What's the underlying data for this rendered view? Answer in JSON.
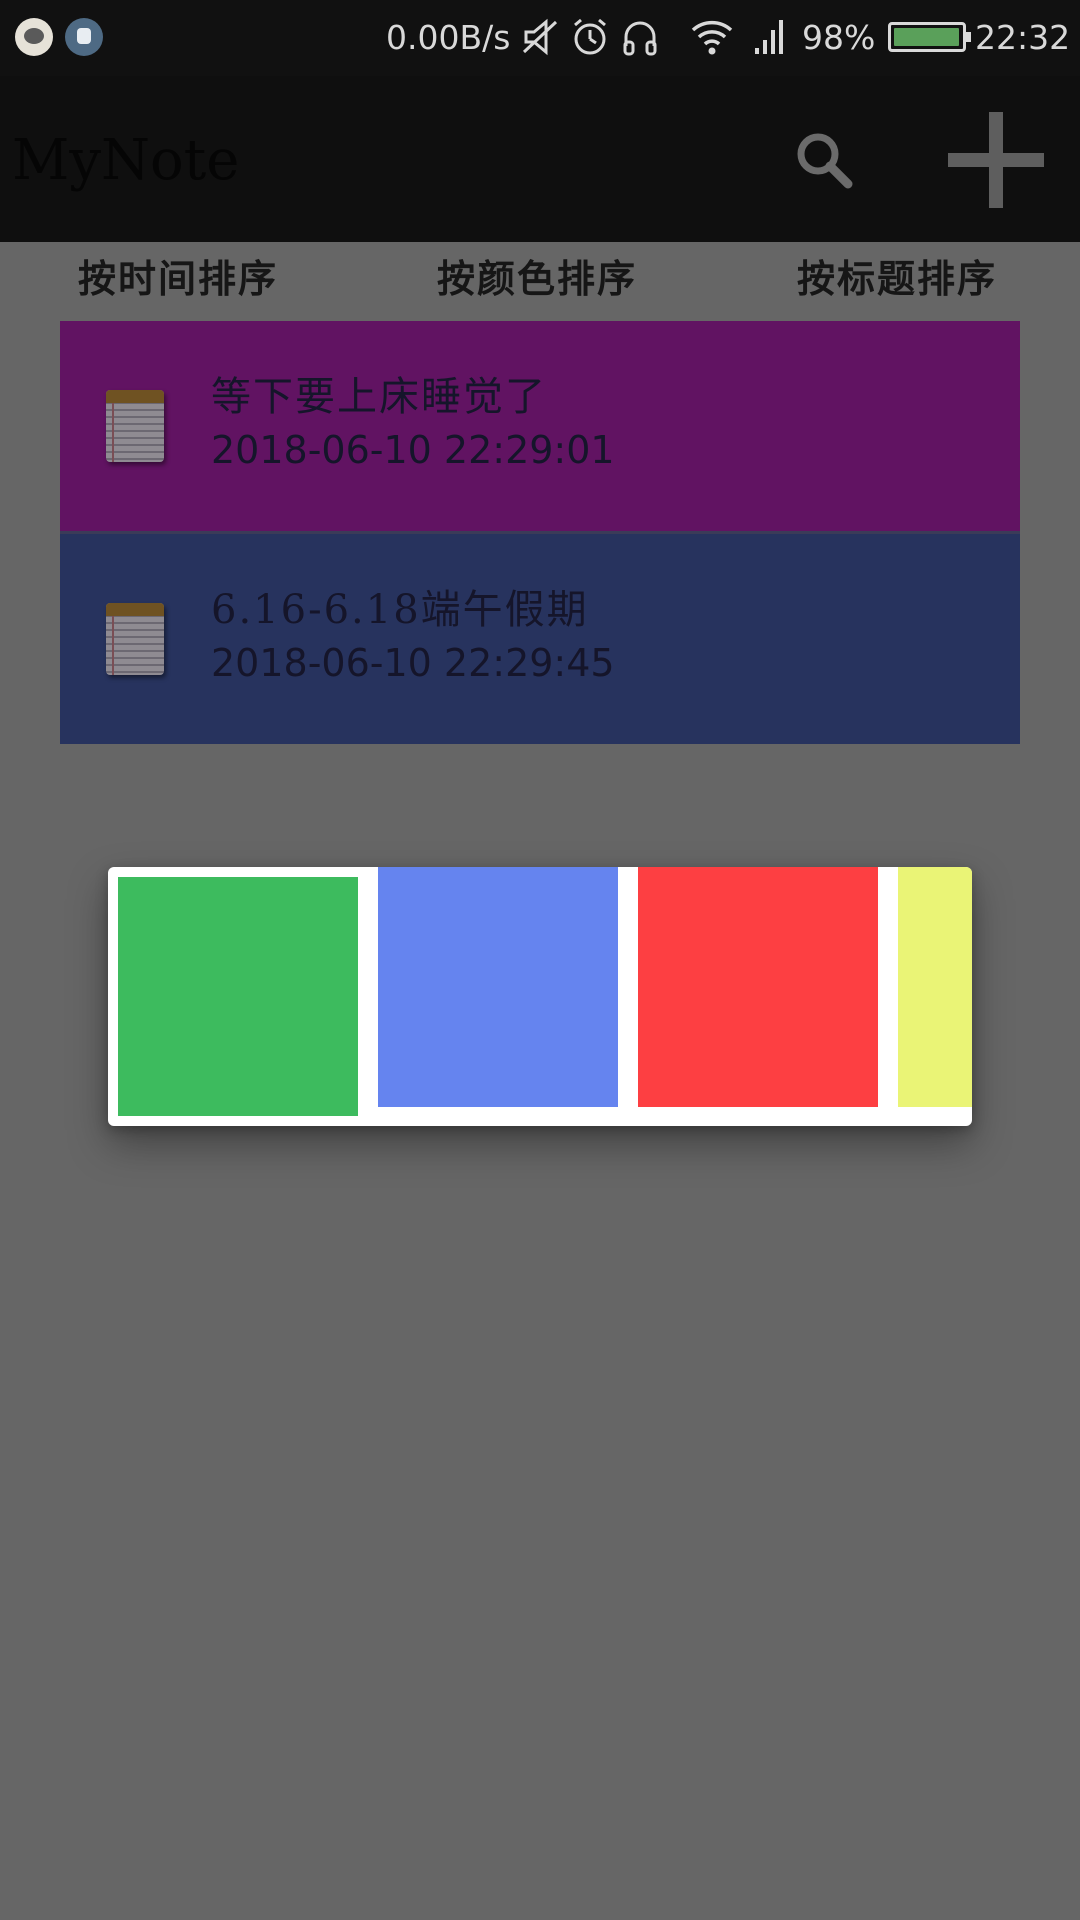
{
  "status_bar": {
    "net_speed": "0.00B/s",
    "battery_percent": "98%",
    "battery_level": 0.98,
    "time": "22:32",
    "icons": [
      "notification-app-icon",
      "notification-robot-icon",
      "vibrate-mute-icon",
      "alarm-icon",
      "headset-icon",
      "wifi-icon",
      "signal-icon",
      "battery-icon"
    ]
  },
  "action_bar": {
    "title": "MyNote",
    "search_icon": "search-icon",
    "add_icon": "plus-icon"
  },
  "sort_tabs": {
    "by_time": "按时间排序",
    "by_color": "按颜色排序",
    "by_title": "按标题排序"
  },
  "notes": [
    {
      "title": "等下要上床睡觉了",
      "timestamp": "2018-06-10  22:29:01",
      "color": "#611362",
      "icon": "notepad-icon"
    },
    {
      "title": "6.16-6.18端午假期",
      "timestamp": "2018-06-10  22:29:45",
      "color": "#27335e",
      "icon": "notepad-icon"
    }
  ],
  "color_picker": {
    "swatches": [
      {
        "name": "green",
        "color": "#3dbb5e"
      },
      {
        "name": "blue",
        "color": "#6584ef"
      },
      {
        "name": "red",
        "color": "#fd3f42"
      },
      {
        "name": "yellow",
        "color": "#eaf476"
      }
    ]
  },
  "colors": {
    "scrim_background": "#666666",
    "status_bar": "#111111",
    "action_bar": "#0f0f0f"
  }
}
